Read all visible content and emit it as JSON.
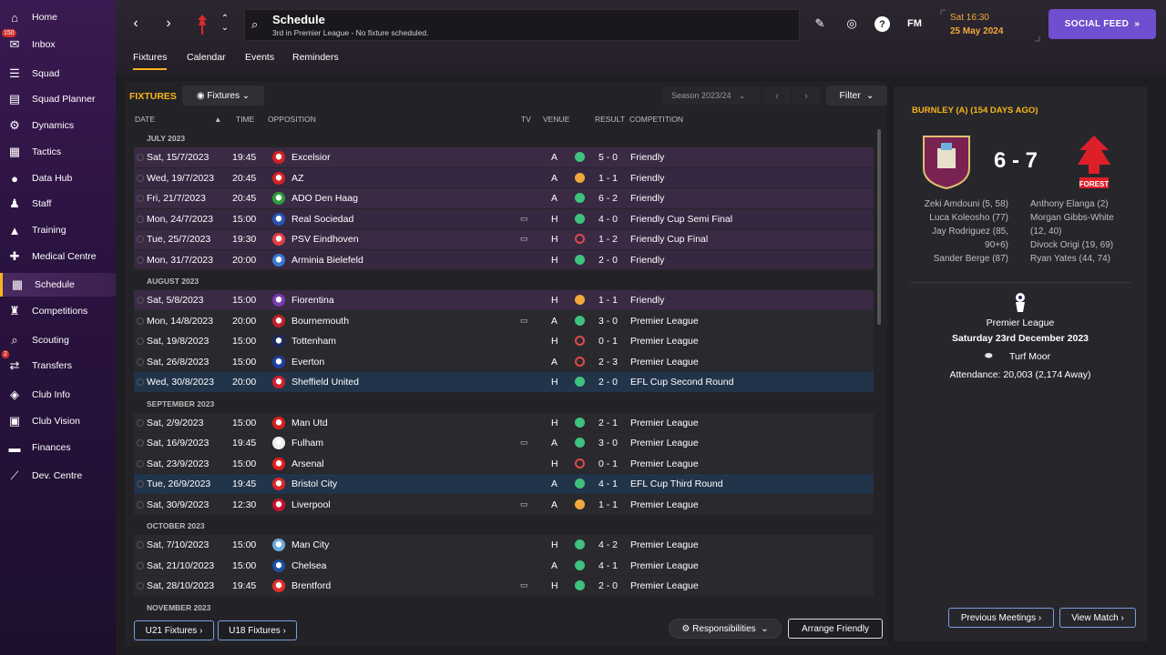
{
  "sidebar": {
    "items": [
      {
        "label": "Home",
        "icon": "home-icon",
        "glyph": "⌂"
      },
      {
        "label": "Inbox",
        "icon": "inbox-icon",
        "glyph": "✉",
        "badge": "150"
      },
      {
        "label": "Squad",
        "icon": "squad-icon",
        "glyph": "☰"
      },
      {
        "label": "Squad Planner",
        "icon": "planner-icon",
        "glyph": "▤"
      },
      {
        "label": "Dynamics",
        "icon": "dynamics-icon",
        "glyph": "⚙"
      },
      {
        "label": "Tactics",
        "icon": "tactics-icon",
        "glyph": "▦"
      },
      {
        "label": "Data Hub",
        "icon": "data-hub-icon",
        "glyph": "●"
      },
      {
        "label": "Staff",
        "icon": "staff-icon",
        "glyph": "♟"
      },
      {
        "label": "Training",
        "icon": "training-icon",
        "glyph": "▲"
      },
      {
        "label": "Medical Centre",
        "icon": "medical-icon",
        "glyph": "✚"
      },
      {
        "label": "Schedule",
        "icon": "schedule-icon",
        "glyph": "▦"
      },
      {
        "label": "Competitions",
        "icon": "trophy-icon",
        "glyph": "♜"
      },
      {
        "label": "Scouting",
        "icon": "scouting-icon",
        "glyph": "⌕"
      },
      {
        "label": "Transfers",
        "icon": "transfers-icon",
        "glyph": "⇄",
        "badge": "2"
      },
      {
        "label": "Club Info",
        "icon": "club-info-icon",
        "glyph": "◈"
      },
      {
        "label": "Club Vision",
        "icon": "club-vision-icon",
        "glyph": "▣"
      },
      {
        "label": "Finances",
        "icon": "finances-icon",
        "glyph": "▬"
      },
      {
        "label": "Dev. Centre",
        "icon": "dev-centre-icon",
        "glyph": "⟋"
      }
    ]
  },
  "header": {
    "title": "Schedule",
    "subtitle": "3rd in Premier League - No fixture scheduled.",
    "time": "Sat 16:30",
    "date": "25 May 2024",
    "social_label": "SOCIAL FEED",
    "fm_label": "FM",
    "help_label": "?"
  },
  "tabs": [
    "Fixtures",
    "Calendar",
    "Events",
    "Reminders"
  ],
  "fixtures": {
    "label": "FIXTURES",
    "view_label": "Fixtures",
    "season_label": "Season 2023/24",
    "filter_label": "Filter",
    "columns": {
      "date": "DATE",
      "time": "TIME",
      "opposition": "OPPOSITION",
      "tv": "TV",
      "venue": "VENUE",
      "result": "RESULT",
      "competition": "COMPETITION"
    },
    "rows": [
      {
        "type": "month",
        "label": "JULY 2023"
      },
      {
        "type": "friendly",
        "date": "Sat, 15/7/2023",
        "time": "19:45",
        "opp": "Excelsior",
        "tv": "",
        "venue": "A",
        "res": "w",
        "score": "5 - 0",
        "comp": "Friendly",
        "crest": "#d32222"
      },
      {
        "type": "friendly",
        "date": "Wed, 19/7/2023",
        "time": "20:45",
        "opp": "AZ",
        "tv": "",
        "venue": "A",
        "res": "d",
        "score": "1 - 1",
        "comp": "Friendly",
        "crest": "#d32222"
      },
      {
        "type": "friendly",
        "date": "Fri, 21/7/2023",
        "time": "20:45",
        "opp": "ADO Den Haag",
        "tv": "",
        "venue": "A",
        "res": "w",
        "score": "6 - 2",
        "comp": "Friendly",
        "crest": "#2e9c3a"
      },
      {
        "type": "friendly",
        "date": "Mon, 24/7/2023",
        "time": "15:00",
        "opp": "Real Sociedad",
        "tv": "▭",
        "venue": "H",
        "res": "w",
        "score": "4 - 0",
        "comp": "Friendly Cup Semi Final",
        "crest": "#2855b5"
      },
      {
        "type": "friendly",
        "date": "Tue, 25/7/2023",
        "time": "19:30",
        "opp": "PSV Eindhoven",
        "tv": "▭",
        "venue": "H",
        "res": "l",
        "score": "1 - 2",
        "comp": "Friendly Cup Final",
        "crest": "#e04040"
      },
      {
        "type": "friendly",
        "date": "Mon, 31/7/2023",
        "time": "20:00",
        "opp": "Arminia Bielefeld",
        "tv": "",
        "venue": "H",
        "res": "w",
        "score": "2 - 0",
        "comp": "Friendly",
        "crest": "#3a7ad0"
      },
      {
        "type": "month",
        "label": "AUGUST 2023"
      },
      {
        "type": "friendly",
        "date": "Sat, 5/8/2023",
        "time": "15:00",
        "opp": "Fiorentina",
        "tv": "",
        "venue": "H",
        "res": "d",
        "score": "1 - 1",
        "comp": "Friendly",
        "crest": "#7a3ab0"
      },
      {
        "type": "plain",
        "date": "Mon, 14/8/2023",
        "time": "20:00",
        "opp": "Bournemouth",
        "tv": "▭",
        "venue": "A",
        "res": "w",
        "score": "3 - 0",
        "comp": "Premier League",
        "crest": "#c0202a"
      },
      {
        "type": "plain",
        "date": "Sat, 19/8/2023",
        "time": "15:00",
        "opp": "Tottenham",
        "tv": "",
        "venue": "H",
        "res": "l",
        "score": "0 - 1",
        "comp": "Premier League",
        "crest": "#1a2a5a"
      },
      {
        "type": "plain",
        "date": "Sat, 26/8/2023",
        "time": "15:00",
        "opp": "Everton",
        "tv": "",
        "venue": "A",
        "res": "l",
        "score": "2 - 3",
        "comp": "Premier League",
        "crest": "#1f3fa0"
      },
      {
        "type": "cup",
        "date": "Wed, 30/8/2023",
        "time": "20:00",
        "opp": "Sheffield United",
        "tv": "",
        "venue": "H",
        "res": "w",
        "score": "2 - 0",
        "comp": "EFL Cup Second Round",
        "crest": "#d02030"
      },
      {
        "type": "month",
        "label": "SEPTEMBER 2023"
      },
      {
        "type": "plain",
        "date": "Sat, 2/9/2023",
        "time": "15:00",
        "opp": "Man Utd",
        "tv": "",
        "venue": "H",
        "res": "w",
        "score": "2 - 1",
        "comp": "Premier League",
        "crest": "#d8201f"
      },
      {
        "type": "plain",
        "date": "Sat, 16/9/2023",
        "time": "19:45",
        "opp": "Fulham",
        "tv": "▭",
        "venue": "A",
        "res": "w",
        "score": "3 - 0",
        "comp": "Premier League",
        "crest": "#eeeeee"
      },
      {
        "type": "plain",
        "date": "Sat, 23/9/2023",
        "time": "15:00",
        "opp": "Arsenal",
        "tv": "",
        "venue": "H",
        "res": "l",
        "score": "0 - 1",
        "comp": "Premier League",
        "crest": "#e02020"
      },
      {
        "type": "cup",
        "date": "Tue, 26/9/2023",
        "time": "19:45",
        "opp": "Bristol City",
        "tv": "",
        "venue": "A",
        "res": "w",
        "score": "4 - 1",
        "comp": "EFL Cup Third Round",
        "crest": "#d82828"
      },
      {
        "type": "plain",
        "date": "Sat, 30/9/2023",
        "time": "12:30",
        "opp": "Liverpool",
        "tv": "▭",
        "venue": "A",
        "res": "d",
        "score": "1 - 1",
        "comp": "Premier League",
        "crest": "#c8102e"
      },
      {
        "type": "month",
        "label": "OCTOBER 2023"
      },
      {
        "type": "plain",
        "date": "Sat, 7/10/2023",
        "time": "15:00",
        "opp": "Man City",
        "tv": "",
        "venue": "H",
        "res": "w",
        "score": "4 - 2",
        "comp": "Premier League",
        "crest": "#6cabdd"
      },
      {
        "type": "plain",
        "date": "Sat, 21/10/2023",
        "time": "15:00",
        "opp": "Chelsea",
        "tv": "",
        "venue": "A",
        "res": "w",
        "score": "4 - 1",
        "comp": "Premier League",
        "crest": "#1a4fa0"
      },
      {
        "type": "plain",
        "date": "Sat, 28/10/2023",
        "time": "19:45",
        "opp": "Brentford",
        "tv": "▭",
        "venue": "H",
        "res": "w",
        "score": "2 - 0",
        "comp": "Premier League",
        "crest": "#e0302a"
      },
      {
        "type": "month",
        "label": "NOVEMBER 2023"
      }
    ],
    "u21_label": "U21 Fixtures ›",
    "u18_label": "U18 Fixtures ›",
    "responsibilities_label": "Responsibilities",
    "arrange_label": "Arrange Friendly"
  },
  "match": {
    "title": "BURNLEY (A) (154 DAYS AGO)",
    "score": "6 - 7",
    "home_scorers": [
      "Zeki Amdouni (5, 58)",
      "Luca Koleosho (77)",
      "Jay Rodriguez (85,",
      "90+6)",
      "Sander Berge (87)"
    ],
    "away_scorers": [
      "Anthony Elanga (2)",
      "Morgan Gibbs-White",
      "(12, 40)",
      "Divock Origi (19, 69)",
      "Ryan Yates (44, 74)"
    ],
    "competition": "Premier League",
    "date": "Saturday 23rd December 2023",
    "stadium": "Turf Moor",
    "attendance": "Attendance: 20,003 (2,174 Away)",
    "prev_label": "Previous Meetings ›",
    "view_label": "View Match ›",
    "forest_text": "FOREST"
  },
  "colors": {
    "accent": "#f7b51c",
    "purple": "#6f4ecf",
    "win": "#3ec27e",
    "draw": "#f2a93b",
    "loss": "#e24a4a"
  }
}
